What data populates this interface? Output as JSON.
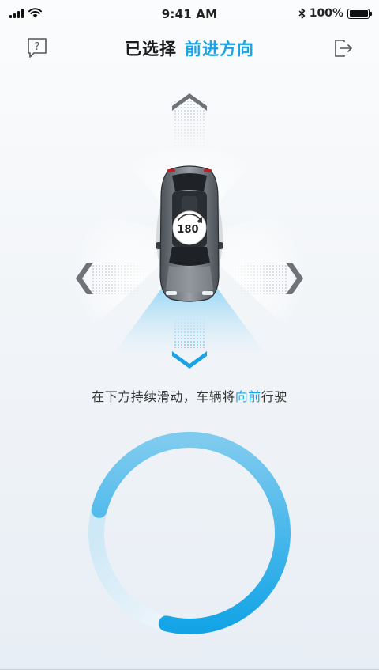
{
  "status_bar": {
    "time": "9:41 AM",
    "battery": "100%",
    "battery_level": 1.0
  },
  "header": {
    "title_prefix": "已选择",
    "title_direction": "前进方向",
    "help_icon": "question-bubble-icon",
    "exit_icon": "exit-arrow-icon"
  },
  "car": {
    "rotate_label": "180",
    "rotate_unit": "°",
    "selected_direction": "down"
  },
  "instruction": {
    "prefix": "在下方持续滑动，车辆将",
    "highlight": "向前",
    "suffix": "行驶"
  },
  "ring": {
    "progress": 0.75
  },
  "colors": {
    "accent": "#19a3e4",
    "arrow_inactive": "#6f7378",
    "ring_light": "#cfe8f6"
  }
}
